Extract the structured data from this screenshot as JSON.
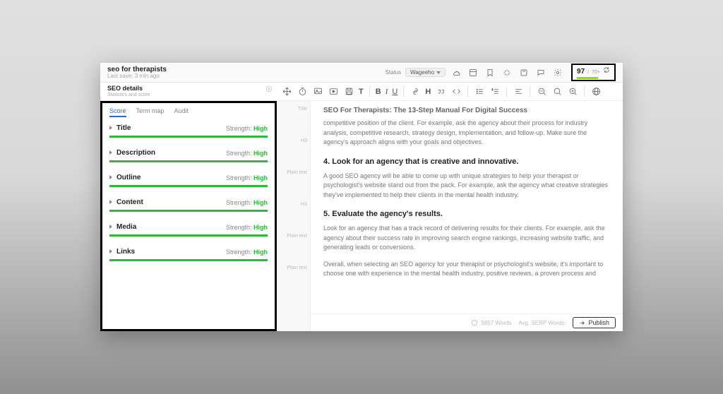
{
  "document": {
    "title": "seo for therapists",
    "last_saved": "Last save: 3 min ago",
    "heading": "SEO For Therapists: The 13-Step Manual For Digital Success"
  },
  "status": {
    "label": "Status",
    "value": "Wageeho"
  },
  "score_widget": {
    "score": "97",
    "separator": "/",
    "max_hint": "70+"
  },
  "seo_panel": {
    "title": "SEO details",
    "subtitle": "Statistics and score"
  },
  "tabs": {
    "score": "Score",
    "term_map": "Term map",
    "audit": "Audit"
  },
  "score_items": [
    {
      "name": "Title",
      "strength_label": "Strength:",
      "strength_value": "High"
    },
    {
      "name": "Description",
      "strength_label": "Strength:",
      "strength_value": "High"
    },
    {
      "name": "Outline",
      "strength_label": "Strength:",
      "strength_value": "High"
    },
    {
      "name": "Content",
      "strength_label": "Strength:",
      "strength_value": "High"
    },
    {
      "name": "Media",
      "strength_label": "Strength:",
      "strength_value": "High"
    },
    {
      "name": "Links",
      "strength_label": "Strength:",
      "strength_value": "High"
    }
  ],
  "gutter": {
    "title": "Title",
    "h3": "H3",
    "plain": "Plain text"
  },
  "content": {
    "p1": "competitive position of the client. For example, ask the agency about their process for industry analysis, competitive research, strategy design, implementation, and follow-up. Make sure the agency's approach aligns with your goals and objectives.",
    "h4": "4. Look for an agency that is creative and innovative.",
    "p2": "A good SEO agency will be able to come up with unique strategies to help your therapist or psychologist's website stand out from the pack. For example, ask the agency what creative strategies they've implemented to help their clients in the mental health industry.",
    "h5": "5. Evaluate the agency's results.",
    "p3": "Look for an agency that has a track record of delivering results for their clients. For example, ask the agency about their success rate in improving search engine rankings, increasing website traffic, and generating leads or conversions.",
    "p4": "Overall, when selecting an SEO agency for your therapist or psychologist's website, it's important to choose one with experience in the mental health industry, positive reviews, a proven process and"
  },
  "footer": {
    "words": "5857 Words",
    "serp": "Avg. SERP Words:",
    "publish": "Publish"
  },
  "toolbar_labels": {
    "bold": "B",
    "italic": "I",
    "underline": "U",
    "heading": "H",
    "text": "T"
  }
}
